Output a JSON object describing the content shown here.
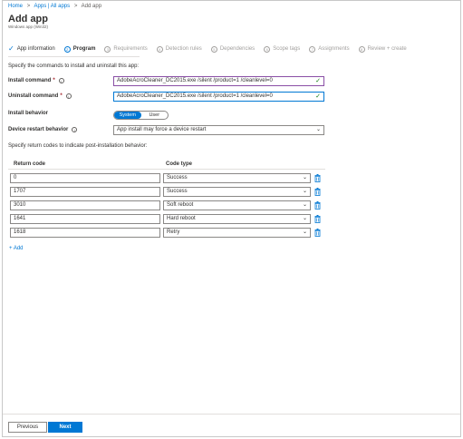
{
  "breadcrumb": {
    "home": "Home",
    "apps": "Apps | All apps",
    "current": "Add app",
    "separator": ">"
  },
  "header": {
    "title": "Add app",
    "subtitle": "Windows app (Win32)"
  },
  "wizard": {
    "steps": [
      {
        "label": "App information",
        "state": "done",
        "marker": "✓"
      },
      {
        "label": "Program",
        "state": "active",
        "marker": "2"
      },
      {
        "label": "Requirements",
        "state": "pending",
        "marker": "3"
      },
      {
        "label": "Detection rules",
        "state": "pending",
        "marker": "4"
      },
      {
        "label": "Dependencies",
        "state": "pending",
        "marker": "5"
      },
      {
        "label": "Scope tags",
        "state": "pending",
        "marker": "6"
      },
      {
        "label": "Assignments",
        "state": "pending",
        "marker": "7"
      },
      {
        "label": "Review + create",
        "state": "pending",
        "marker": "8"
      }
    ]
  },
  "program": {
    "intro": "Specify the commands to install and uninstall this app:",
    "install_label": "Install command",
    "install_value": "AdobeAcroCleaner_DC2015.exe /silent /product=1 /cleanlevel=0",
    "uninstall_label": "Uninstall command",
    "uninstall_value": "AdobeAcroCleaner_DC2015.exe /silent /product=1 /cleanlevel=0",
    "required_marker": "*",
    "info_glyph": "i",
    "valid_glyph": "✓",
    "behavior_label": "Install behavior",
    "behavior_options": [
      "System",
      "User"
    ],
    "behavior_selected": "System",
    "restart_label": "Device restart behavior",
    "restart_value": "App install may force a device restart"
  },
  "return_codes": {
    "intro": "Specify return codes to indicate post-installation behavior:",
    "col_code": "Return code",
    "col_type": "Code type",
    "rows": [
      {
        "code": "0",
        "type": "Success"
      },
      {
        "code": "1707",
        "type": "Success"
      },
      {
        "code": "3010",
        "type": "Soft reboot"
      },
      {
        "code": "1641",
        "type": "Hard reboot"
      },
      {
        "code": "1618",
        "type": "Retry"
      }
    ],
    "add_label": "+ Add"
  },
  "footer": {
    "previous_label": "Previous",
    "next_label": "Next"
  },
  "colors": {
    "accent": "#0078d4",
    "required": "#a4262c",
    "valid": "#107c10",
    "focus_purple": "#8a4fa6"
  },
  "icons": {
    "step_done": "check-icon",
    "info": "info-icon",
    "delete": "trash-icon",
    "dropdown": "chevron-down-icon"
  }
}
